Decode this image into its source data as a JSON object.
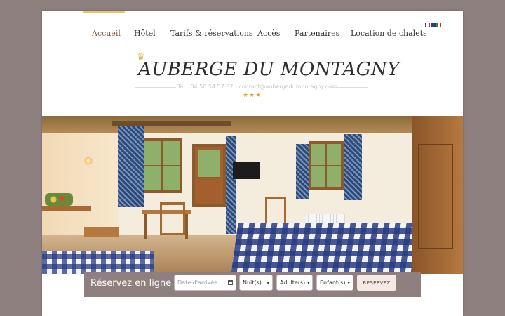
{
  "nav": {
    "items": [
      {
        "label": "Accueil",
        "active": true
      },
      {
        "label": "Hôtel"
      },
      {
        "label": "Tarifs & réservations"
      },
      {
        "label": "Accès"
      },
      {
        "label": "Partenaires"
      },
      {
        "label": "Location de chalets"
      }
    ],
    "languages": [
      "fr-flag-icon",
      "en-flag-icon",
      "it-flag-icon"
    ]
  },
  "brand": {
    "crown_icon": "crown-icon",
    "name": "AUBERGE DU MONTAGNY",
    "contact": "Tél : 04 50 54 57 37 - contact@aubergedumontagny.com",
    "stars": "★★★"
  },
  "hero": {
    "image": "hotel-room-photo"
  },
  "booking": {
    "title": "Réservez en ligne :",
    "date_placeholder": "Date d'arrivée",
    "nights": "Nuit(s)",
    "adults": "Adulte(s)",
    "children": "Enfant(s)",
    "submit": "RESERVEZ"
  },
  "colors": {
    "background": "#8f8080",
    "accent": "#e6c76a",
    "active_link": "#8a5a3c",
    "stars": "#e3a83a"
  }
}
